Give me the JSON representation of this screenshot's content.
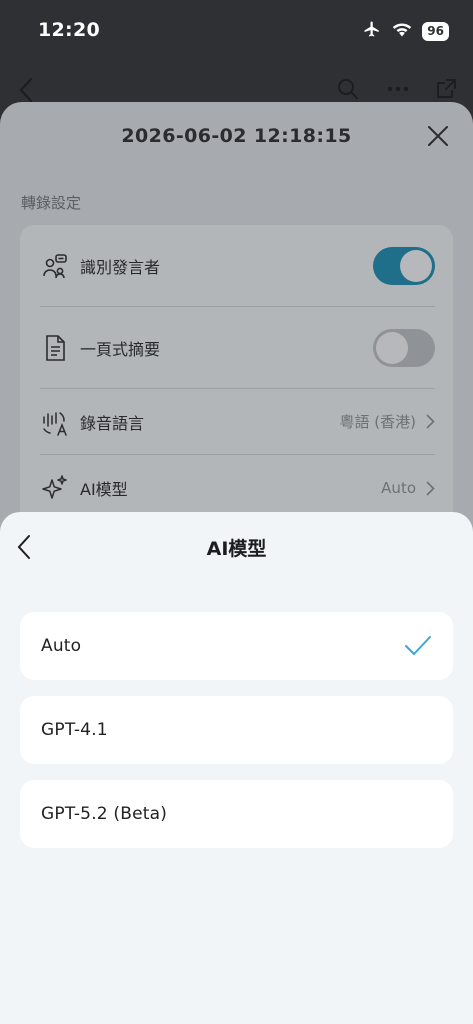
{
  "status_bar": {
    "time": "12:20",
    "battery": "96"
  },
  "settings": {
    "title": "2026-06-02 12:18:15",
    "section_label": "轉錄設定",
    "rows": [
      {
        "label": "識別發言者",
        "toggle": true,
        "icon": "speaker-identify-icon"
      },
      {
        "label": "一頁式摘要",
        "toggle": false,
        "icon": "document-icon"
      },
      {
        "label": "錄音語言",
        "value": "粵語 (香港)",
        "icon": "language-icon"
      },
      {
        "label": "AI模型",
        "value": "Auto",
        "icon": "sparkle-icon"
      }
    ]
  },
  "model_sheet": {
    "title": "AI模型",
    "options": [
      {
        "label": "Auto",
        "selected": true
      },
      {
        "label": "GPT-4.1",
        "selected": false
      },
      {
        "label": "GPT-5.2 (Beta)",
        "selected": false
      }
    ]
  },
  "colors": {
    "accent": "#3aa7d6",
    "toggle_on_dimmed": "#1f6f8a",
    "sheet_bg": "#f2f5f8"
  }
}
